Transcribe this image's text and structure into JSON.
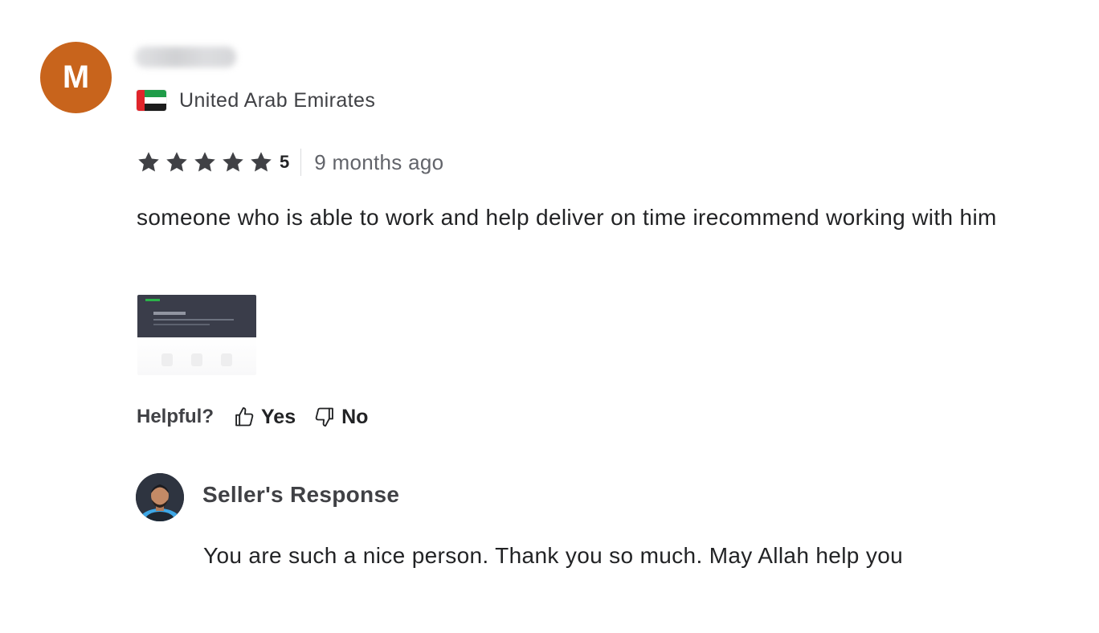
{
  "review": {
    "avatar_initial": "M",
    "avatar_color": "#c8641c",
    "country": "United Arab Emirates",
    "rating": {
      "stars_filled": 5,
      "stars_total": 5,
      "score": "5",
      "star_color": "#404145"
    },
    "time_ago": "9 months ago",
    "text": "someone who is able to work and help deliver on time irecommend working with him",
    "helpful": {
      "label": "Helpful?",
      "yes_label": "Yes",
      "no_label": "No"
    }
  },
  "seller_response": {
    "title": "Seller's Response",
    "text": "You are such a nice person. Thank you so much. May Allah help you"
  },
  "icons": {
    "country_flag": "uae-flag-icon",
    "star": "star-icon",
    "yes": "thumbs-up-icon",
    "no": "thumbs-down-icon"
  }
}
